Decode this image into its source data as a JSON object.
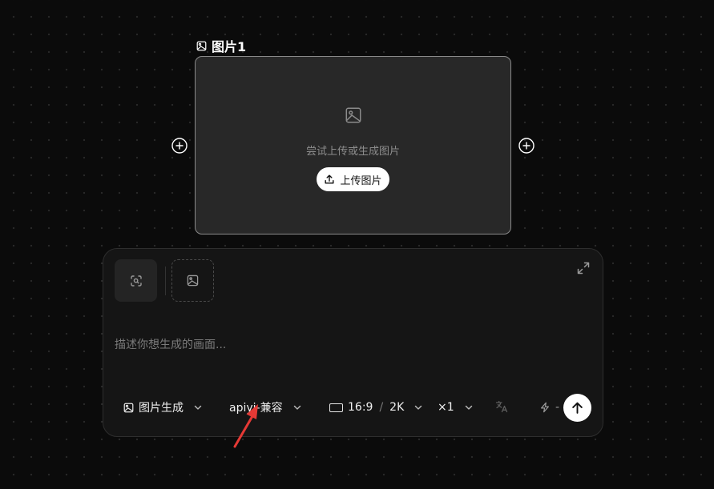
{
  "node": {
    "title": "图片1",
    "empty_hint": "尝试上传或生成图片",
    "upload_label": "上传图片"
  },
  "prompt": {
    "placeholder": "描述你想生成的画面..."
  },
  "toolbar": {
    "mode_label": "图片生成",
    "model_label": "apiyi-兼容",
    "aspect_ratio": "16:9",
    "ratio_separator": "/",
    "resolution": "2K",
    "count": "×1",
    "cost": "-"
  },
  "colors": {
    "background": "#0b0b0b",
    "node_surface": "#282828",
    "panel_surface": "#151515",
    "annotation_arrow": "#e53935",
    "primary_button": "#ffffff"
  },
  "icons": {
    "node_title": "image-icon",
    "empty_state": "image-icon",
    "upload": "upload-icon",
    "add_node": "plus-circle-icon",
    "reference": "scan-search-icon",
    "add_image": "image-icon",
    "expand": "expand-icon",
    "mode": "image-icon",
    "ratio": "rectangle-icon",
    "translate": "translate-icon",
    "cost": "lightning-icon",
    "send": "arrow-up-icon"
  }
}
